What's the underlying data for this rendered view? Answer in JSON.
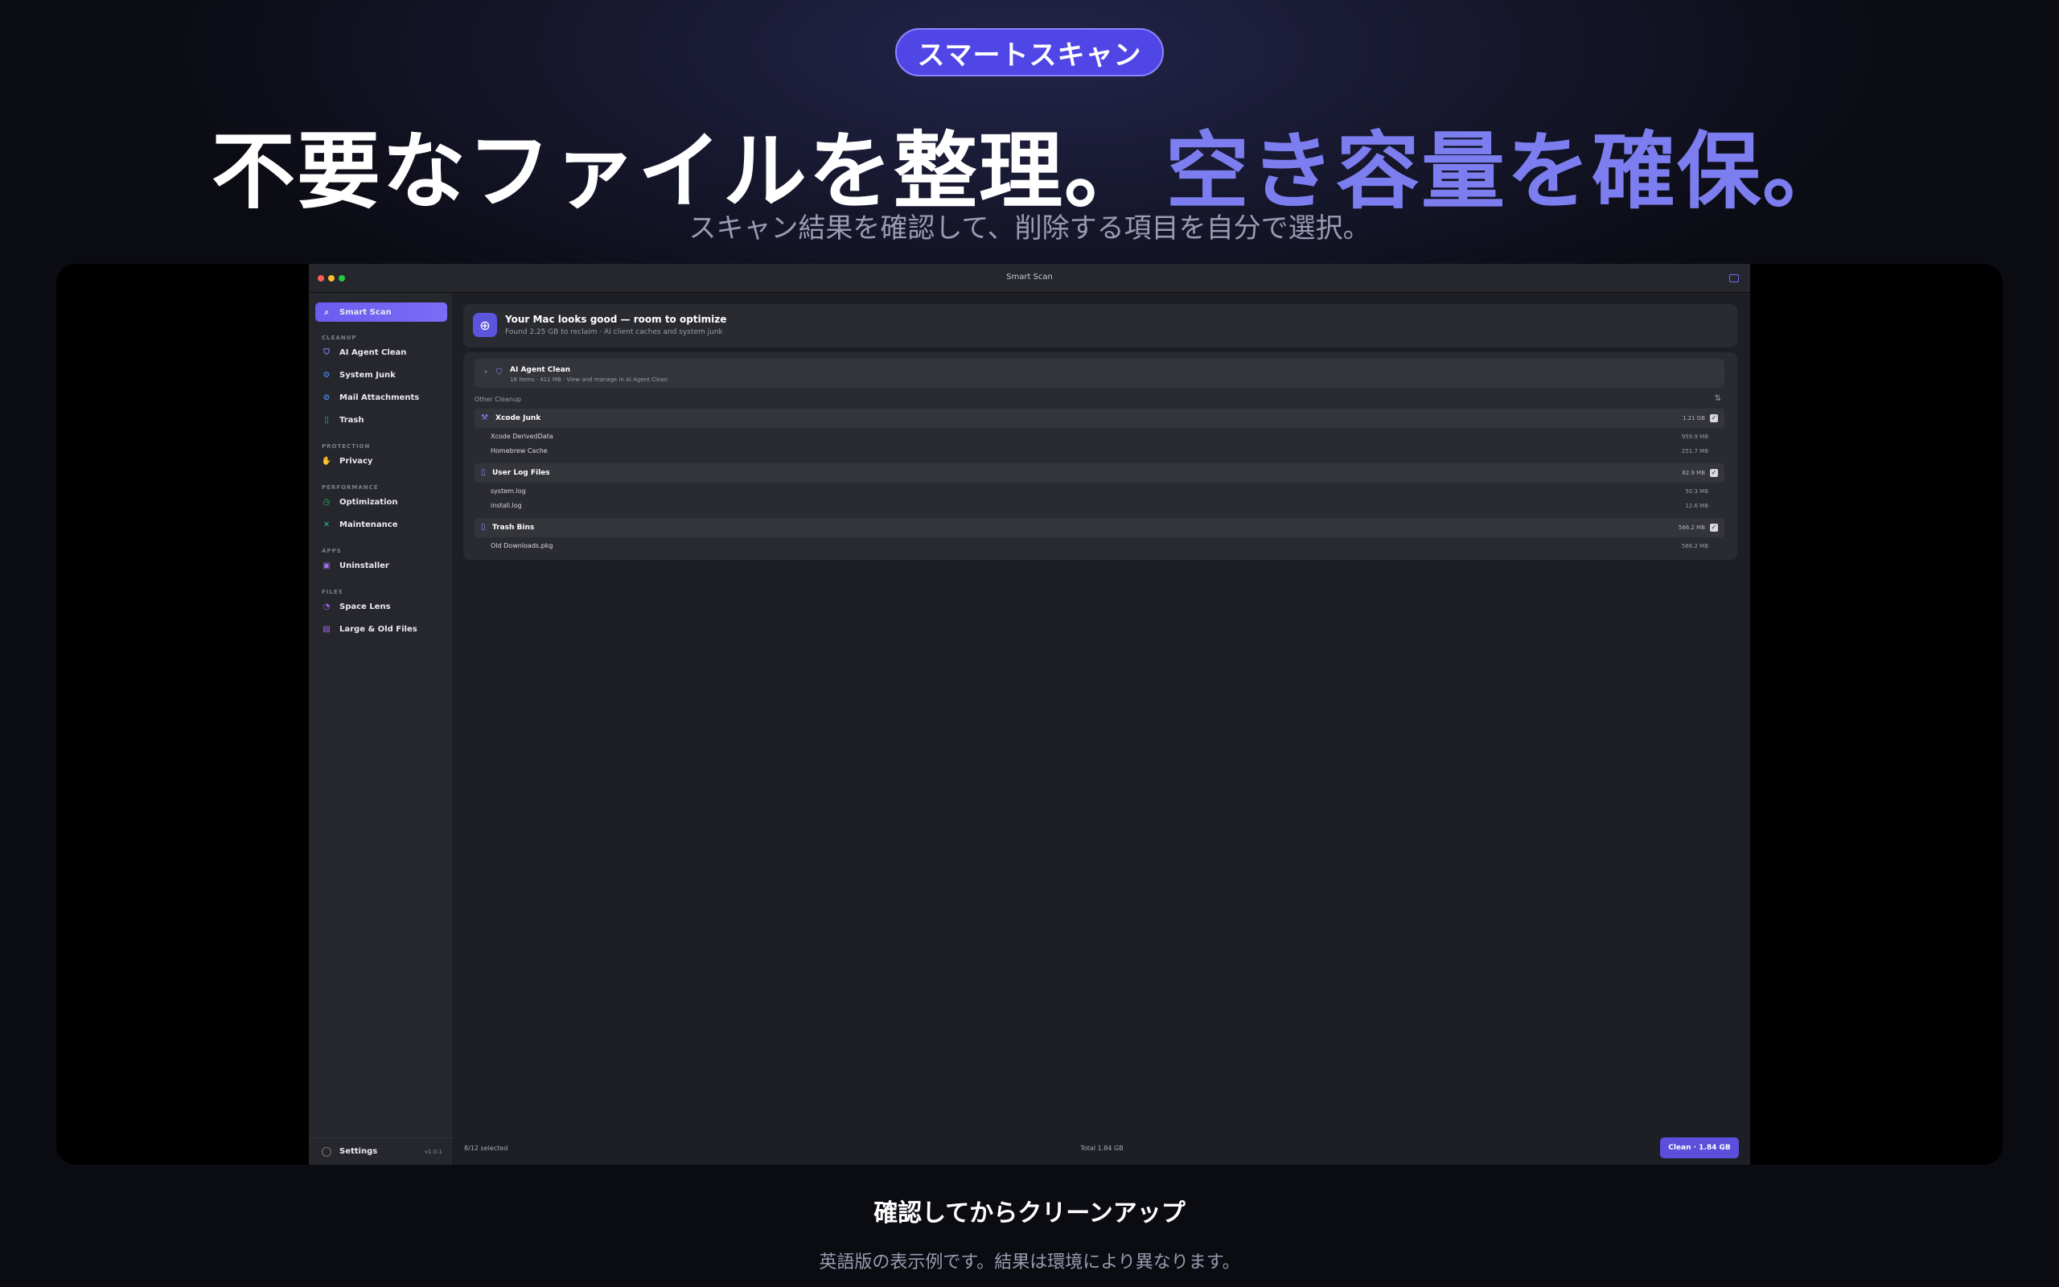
{
  "hero": {
    "badge": "スマートスキャン",
    "headline_white": "不要なファイルを整理。",
    "headline_accent": "空き容量を確保。",
    "subheadline": "スキャン結果を確認して、削除する項目を自分で選択。"
  },
  "window": {
    "title": "Smart Scan"
  },
  "sidebar": {
    "active": {
      "label": "Smart Scan",
      "icon": "magnifier-icon"
    },
    "sections": [
      {
        "title": "CLEANUP",
        "items": [
          {
            "label": "AI Agent Clean",
            "icon": "shield-icon",
            "color": "#8f82ff"
          },
          {
            "label": "System Junk",
            "icon": "gear-icon",
            "color": "#4a8ff5"
          },
          {
            "label": "Mail Attachments",
            "icon": "paperclip-icon",
            "color": "#4a8ff5"
          },
          {
            "label": "Trash",
            "icon": "trash-icon",
            "color": "#2bb5a0"
          }
        ]
      },
      {
        "title": "PROTECTION",
        "items": [
          {
            "label": "Privacy",
            "icon": "hand-icon",
            "color": "#f5a623"
          }
        ]
      },
      {
        "title": "PERFORMANCE",
        "items": [
          {
            "label": "Optimization",
            "icon": "gauge-icon",
            "color": "#2bb55a"
          },
          {
            "label": "Maintenance",
            "icon": "wrench-icon",
            "color": "#2bb5a0"
          }
        ]
      },
      {
        "title": "APPS",
        "items": [
          {
            "label": "Uninstaller",
            "icon": "app-icon",
            "color": "#a66bf5"
          }
        ]
      },
      {
        "title": "FILES",
        "items": [
          {
            "label": "Space Lens",
            "icon": "lens-icon",
            "color": "#a66bf5"
          },
          {
            "label": "Large & Old Files",
            "icon": "file-icon",
            "color": "#a66bf5"
          }
        ]
      }
    ],
    "settings": {
      "label": "Settings",
      "version": "v1.0.1"
    }
  },
  "status": {
    "title": "Your Mac looks good — room to optimize",
    "subtitle": "Found 2.25 GB to reclaim · AI client caches and system junk"
  },
  "agent": {
    "title": "AI Agent Clean",
    "subtitle": "16 items · 411 MB · View and manage in AI Agent Clean"
  },
  "other": {
    "label": "Other Cleanup",
    "groups": [
      {
        "title": "Xcode Junk",
        "size": "1.21 GB",
        "check": "✓",
        "children": [
          {
            "name": "Xcode DerivedData",
            "size": "959.9 MB"
          },
          {
            "name": "Homebrew Cache",
            "size": "251.7 MB"
          }
        ]
      },
      {
        "title": "User Log Files",
        "size": "62.9 MB",
        "check": "✓",
        "children": [
          {
            "name": "system.log",
            "size": "50.3 MB"
          },
          {
            "name": "install.log",
            "size": "12.6 MB"
          }
        ]
      },
      {
        "title": "Trash Bins",
        "size": "566.2 MB",
        "check": "✓",
        "children": [
          {
            "name": "Old Downloads.pkg",
            "size": "566.2 MB"
          }
        ]
      }
    ]
  },
  "footer": {
    "selected": "8/12 selected",
    "total": "Total 1.84 GB",
    "clean_button": "Clean · 1.84 GB"
  },
  "caption": {
    "title": "確認してからクリーンアップ",
    "note": "英語版の表示例です。結果は環境により異なります。"
  }
}
